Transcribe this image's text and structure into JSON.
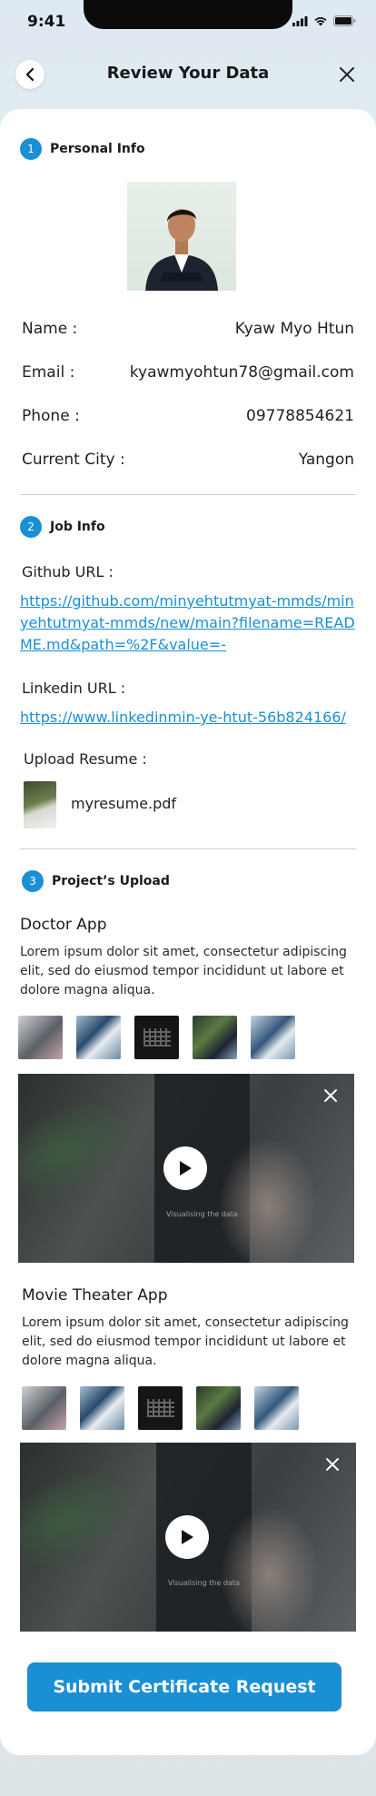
{
  "status_bar": {
    "time": "9:41"
  },
  "header": {
    "title": "Review Your Data"
  },
  "personal": {
    "step": "1",
    "title": "Personal Info",
    "fields": [
      {
        "label": "Name :",
        "value": "Kyaw Myo Htun"
      },
      {
        "label": "Email :",
        "value": "kyawmyohtun78@gmail.com"
      },
      {
        "label": "Phone :",
        "value": "09778854621"
      },
      {
        "label": "Current City :",
        "value": "Yangon"
      }
    ]
  },
  "job": {
    "step": "2",
    "title": "Job Info",
    "github_label": "Github URL :",
    "github_url": "https://github.com/minyehtutmyat-mmds/minyehtutmyat-mmds/new/main?filename=README.md&path=%2F&value=-",
    "linkedin_label": "Linkedin URL :",
    "linkedin_url": "https://www.linkedinmin-ye-htut-56b824166/",
    "resume_label": "Upload Resume :",
    "resume_file": "myresume.pdf"
  },
  "projects": {
    "step": "3",
    "title": "Project’s Upload",
    "items": [
      {
        "name": "Doctor App",
        "description": "Lorem ipsum dolor sit amet, consectetur adipiscing elit, sed do eiusmod tempor incididunt ut labore et dolore magna aliqua.",
        "video_caption": "Visualising the data"
      },
      {
        "name": "Movie Theater App",
        "description": "Lorem ipsum dolor sit amet, consectetur adipiscing elit, sed do eiusmod tempor incididunt ut labore et dolore magna aliqua.",
        "video_caption": "Visualising the data"
      }
    ]
  },
  "submit_label": "Submit Certificate Request",
  "colors": {
    "accent": "#1a8fd4",
    "link": "#1a8fd4"
  },
  "icons": {
    "back": "chevron-left-icon",
    "close": "close-icon",
    "play": "play-icon",
    "signal": "signal-icon",
    "wifi": "wifi-icon",
    "battery": "battery-icon"
  }
}
